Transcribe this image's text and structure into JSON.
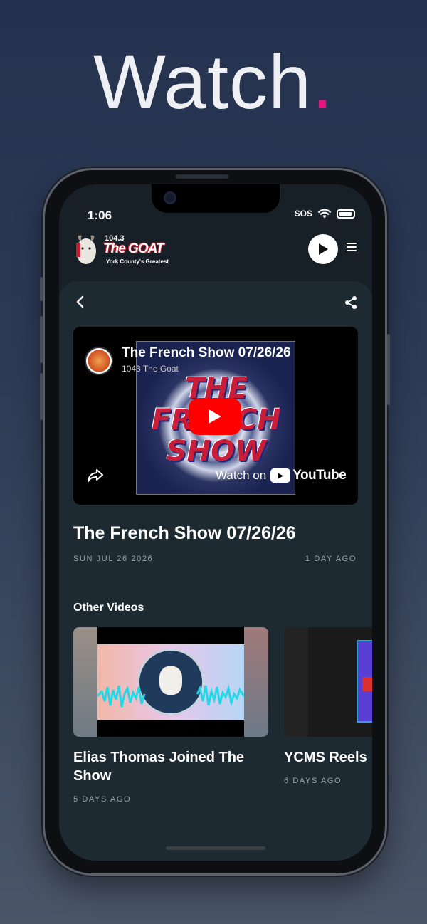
{
  "headline": {
    "word": "Watch",
    "dot": ".",
    "accent": "#e8147d"
  },
  "status_bar": {
    "time": "1:06",
    "sos": "SOS"
  },
  "app": {
    "logo": {
      "frequency": "104.3",
      "name": "The GOAT",
      "tagline": "York County's Greatest"
    }
  },
  "video": {
    "title": "The French Show 07/26/26",
    "channel": "1043 The Goat",
    "thumbnail_text": "THE FRENCH SHOW",
    "watch_on": "Watch on",
    "youtube": "YouTube"
  },
  "detail": {
    "title": "The French Show 07/26/26",
    "date": "SUN JUL 26 2026",
    "ago": "1 DAY AGO"
  },
  "other_videos": {
    "heading": "Other Videos",
    "items": [
      {
        "title": "Elias Thomas Joined The Show",
        "ago": "5 DAYS AGO"
      },
      {
        "title": "YCMS Reels",
        "ago": "6 DAYS AGO"
      }
    ]
  }
}
